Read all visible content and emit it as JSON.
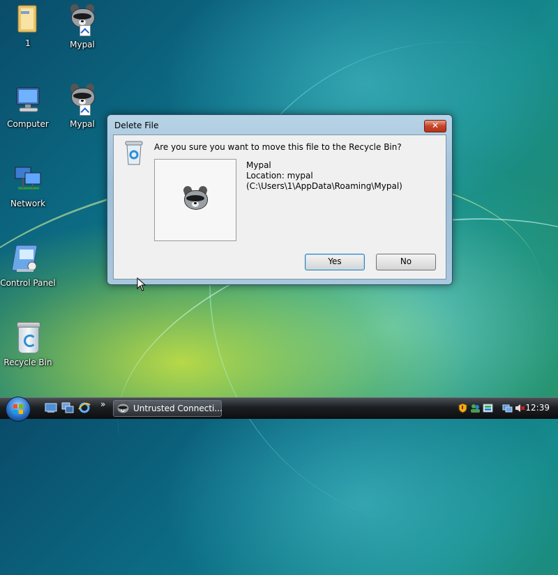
{
  "desktop": {
    "icons": [
      {
        "label": "1",
        "icon": "folder-icon"
      },
      {
        "label": "Mypal",
        "icon": "raccoon-shortcut-icon"
      },
      {
        "label": "Computer",
        "icon": "computer-icon"
      },
      {
        "label": "Mypal",
        "icon": "raccoon-shortcut-icon"
      },
      {
        "label": "Network",
        "icon": "network-icon"
      },
      {
        "label": "Control Panel",
        "icon": "control-panel-icon"
      },
      {
        "label": "Recycle Bin",
        "icon": "recycle-bin-icon"
      }
    ]
  },
  "dialog": {
    "title": "Delete File",
    "close_label": "✕",
    "question": "Are you sure you want to move this file to the Recycle Bin?",
    "file_name": "Mypal",
    "location_line": "Location: mypal",
    "path_line": "(C:\\Users\\1\\AppData\\Roaming\\Mypal)",
    "yes_label": "Yes",
    "no_label": "No"
  },
  "taskbar": {
    "task_label": "Untrusted Connecti...",
    "overflow_label": "»",
    "clock": "12:39"
  },
  "colors": {
    "taskbar": "#1c1f22",
    "dialog_frame": "#a9c7dd",
    "close_button": "#c4452a"
  }
}
